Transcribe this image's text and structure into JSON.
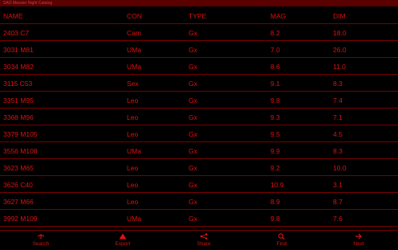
{
  "title": "SAO Messier Night Catalog",
  "columns": [
    "NAME",
    "CON",
    "TYPE",
    "MAG",
    "DIM"
  ],
  "rows": [
    [
      "2403 C7",
      "Cam",
      "Gx",
      "8.2",
      "18.0"
    ],
    [
      "3031 M81",
      "UMa",
      "Gx",
      "7.0",
      "26.0"
    ],
    [
      "3034 M82",
      "UMa",
      "Gx",
      "8.6",
      "11.0"
    ],
    [
      "3115 C53",
      "Sex",
      "Gx",
      "9.1",
      "8.3"
    ],
    [
      "3351 M95",
      "Leo",
      "Gx",
      "9.8",
      "7.4"
    ],
    [
      "3368 M96",
      "Leo",
      "Gx",
      "9.3",
      "7.1"
    ],
    [
      "3379 M105",
      "Leo",
      "Gx",
      "9.5",
      "4.5"
    ],
    [
      "3556 M108",
      "UMa",
      "Gx",
      "9.9",
      "8.3"
    ],
    [
      "3623 M65",
      "Leo",
      "Gx",
      "9.2",
      "10.0"
    ],
    [
      "3626 C40",
      "Leo",
      "Gx",
      "10.9",
      "3.1"
    ],
    [
      "3627 M66",
      "Leo",
      "Gx",
      "8.9",
      "8.7"
    ],
    [
      "3992 M109",
      "UMa",
      "Gx",
      "9.8",
      "7.6"
    ]
  ],
  "toolbar": [
    {
      "label": "Search",
      "icon": "search-icon"
    },
    {
      "label": "Export",
      "icon": "export-icon"
    },
    {
      "label": "Share",
      "icon": "share-icon"
    },
    {
      "label": "Find",
      "icon": "find-icon"
    },
    {
      "label": "Next",
      "icon": "next-icon"
    }
  ],
  "colors": {
    "accent": "#e01010",
    "background": "#000000",
    "divider": "#7a0000",
    "titlebar": "#5a0000"
  }
}
